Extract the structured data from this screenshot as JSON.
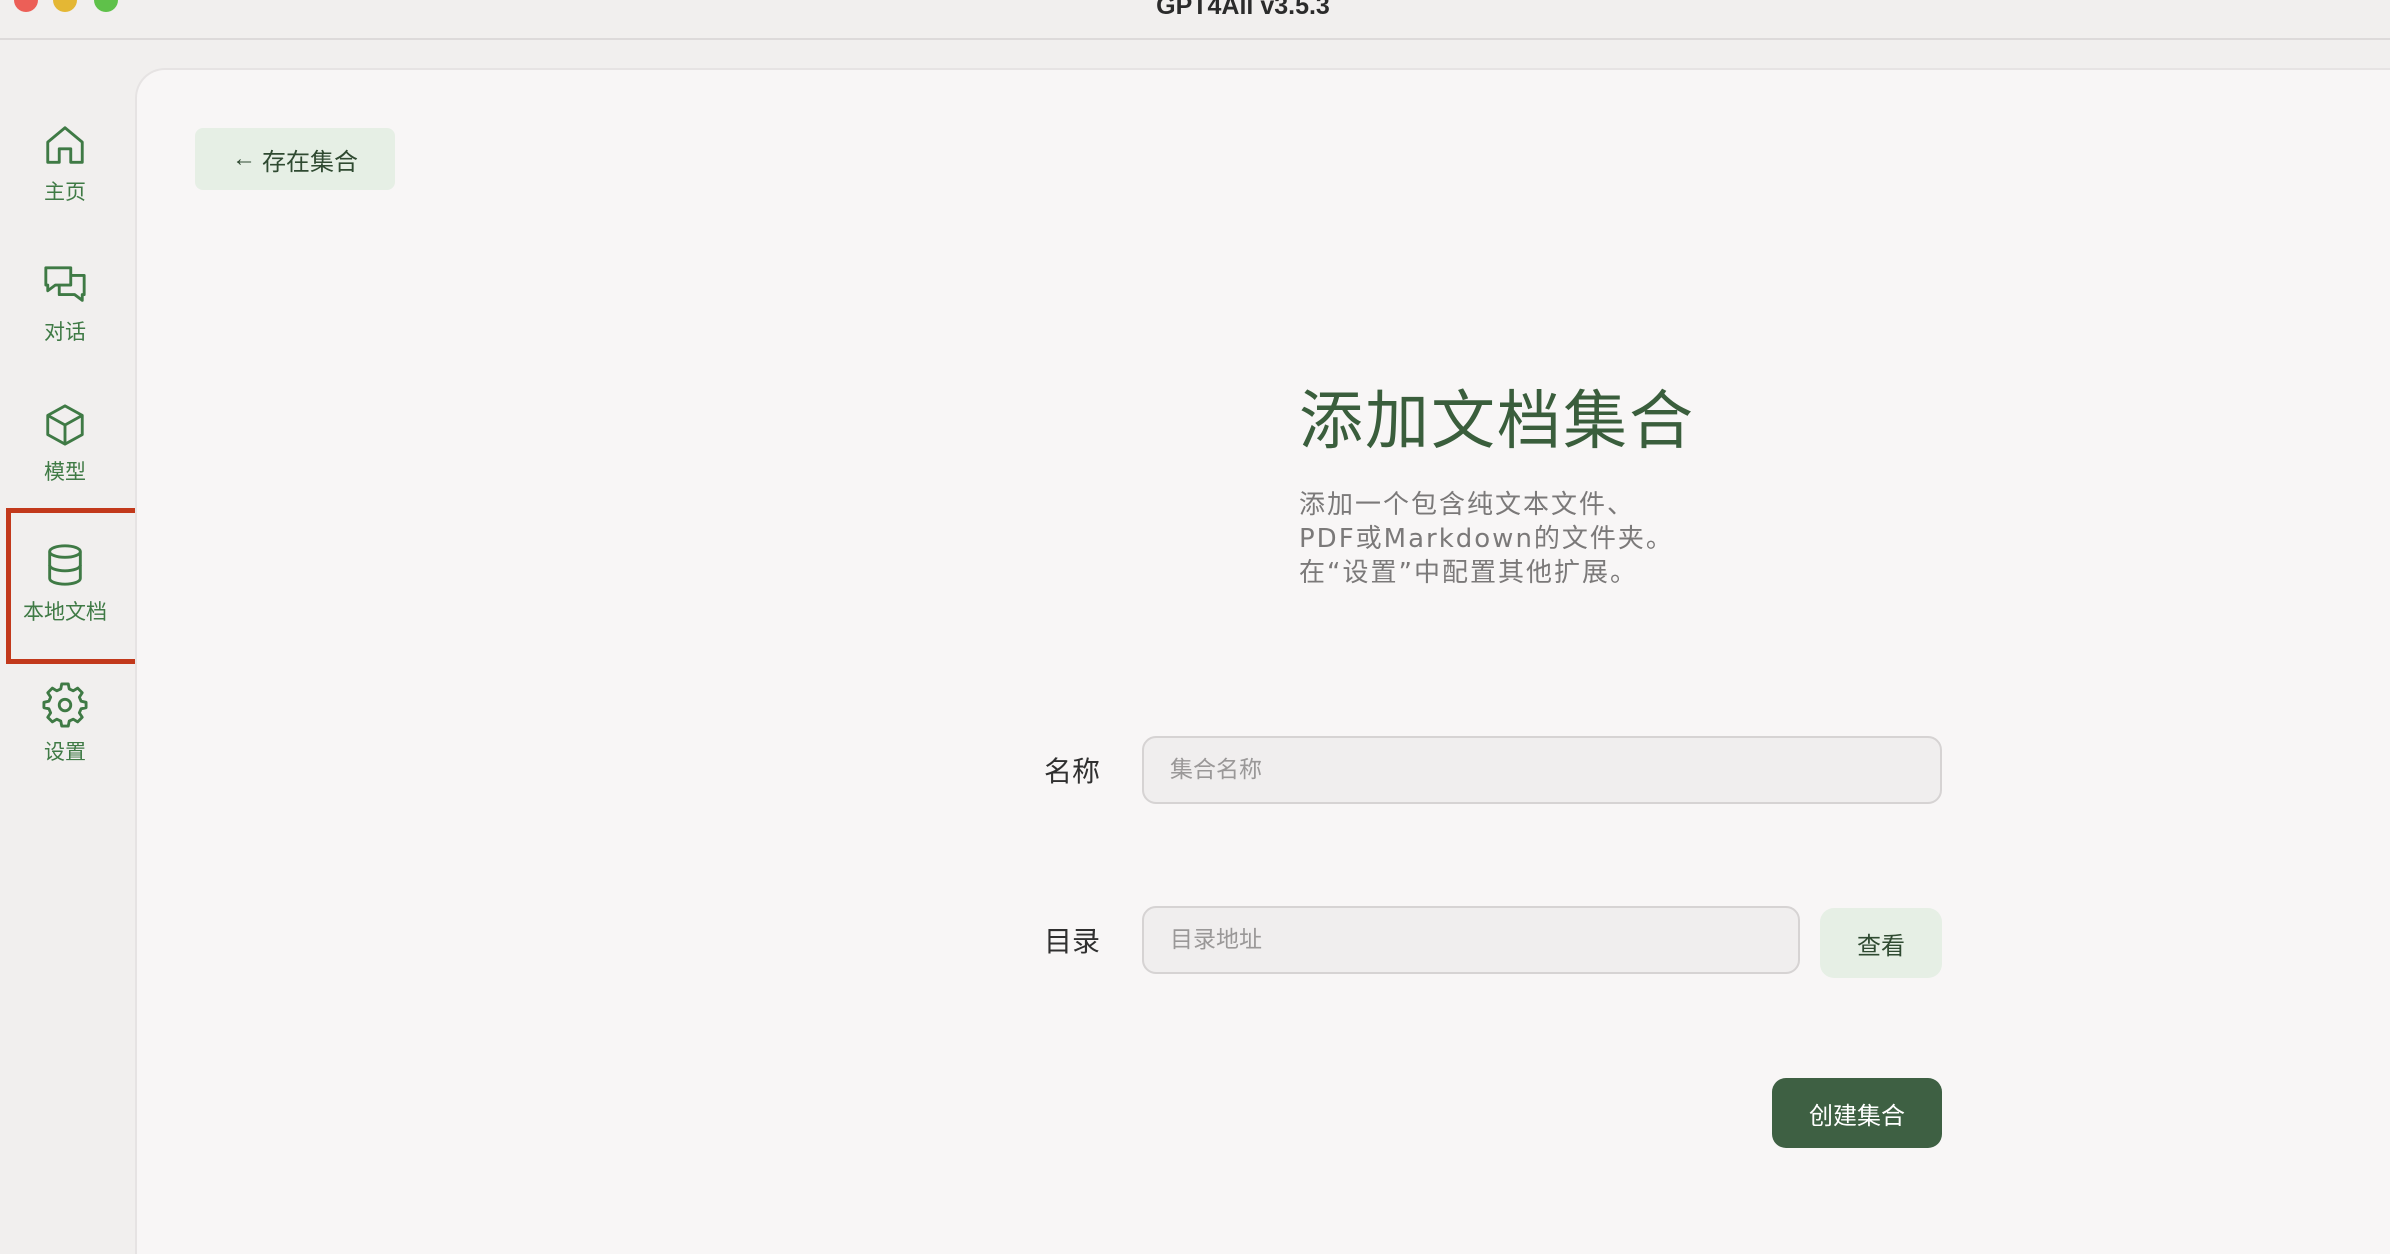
{
  "window": {
    "title": "GPT4All v3.5.3"
  },
  "sidebar": {
    "items": [
      {
        "label": "主页",
        "icon": "home-icon"
      },
      {
        "label": "对话",
        "icon": "chat-icon"
      },
      {
        "label": "模型",
        "icon": "cube-icon"
      },
      {
        "label": "本地文档",
        "icon": "database-icon",
        "highlighted": true
      },
      {
        "label": "设置",
        "icon": "gear-icon"
      }
    ]
  },
  "main": {
    "back_label": "存在集合",
    "title": "添加文档集合",
    "description_lines": [
      "添加一个包含纯文本文件、",
      "PDF或Markdown的文件夹。",
      "在“设置”中配置其他扩展。"
    ],
    "name_field": {
      "label": "名称",
      "placeholder": "集合名称",
      "value": ""
    },
    "folder_field": {
      "label": "目录",
      "placeholder": "目录地址",
      "value": ""
    },
    "browse_label": "查看",
    "create_label": "创建集合"
  },
  "colors": {
    "accent_green": "#3e6043",
    "sidebar_icon": "#3f7a45",
    "highlight_box": "#c2391b",
    "light_button": "#e6efe5"
  }
}
